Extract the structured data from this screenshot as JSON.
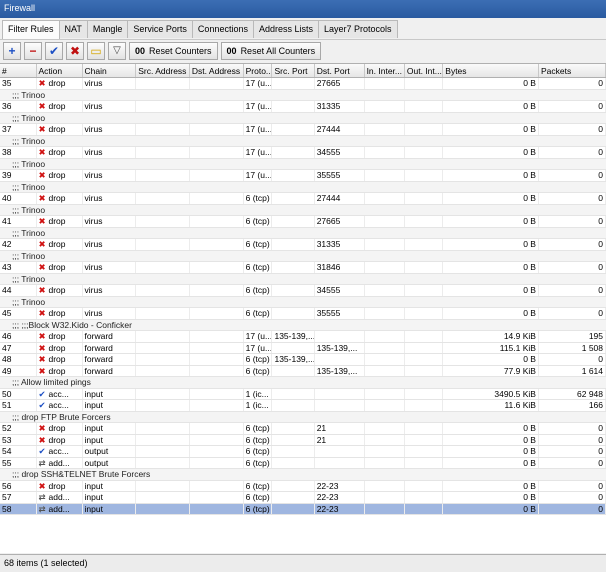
{
  "window": {
    "title": "Firewall"
  },
  "tabs": [
    "Filter Rules",
    "NAT",
    "Mangle",
    "Service Ports",
    "Connections",
    "Address Lists",
    "Layer7 Protocols"
  ],
  "toolbar": {
    "reset_counters": "Reset Counters",
    "reset_all_counters": "Reset All Counters",
    "oo": "00"
  },
  "columns": [
    "#",
    "Action",
    "Chain",
    "Src. Address",
    "Dst. Address",
    "Proto...",
    "Src. Port",
    "Dst. Port",
    "In. Inter...",
    "Out. Int...",
    "Bytes",
    "Packets"
  ],
  "rows": [
    {
      "type": "rule",
      "n": "35",
      "icon": "x",
      "action": "drop",
      "chain": "virus",
      "src": "",
      "dst": "",
      "proto": "17 (u...",
      "sport": "",
      "dport": "27665",
      "in": "",
      "out": "",
      "bytes": "0 B",
      "packets": "0"
    },
    {
      "type": "comment",
      "text": ";;; Trinoo"
    },
    {
      "type": "rule",
      "n": "36",
      "icon": "x",
      "action": "drop",
      "chain": "virus",
      "src": "",
      "dst": "",
      "proto": "17 (u...",
      "sport": "",
      "dport": "31335",
      "in": "",
      "out": "",
      "bytes": "0 B",
      "packets": "0"
    },
    {
      "type": "comment",
      "text": ";;; Trinoo"
    },
    {
      "type": "rule",
      "n": "37",
      "icon": "x",
      "action": "drop",
      "chain": "virus",
      "src": "",
      "dst": "",
      "proto": "17 (u...",
      "sport": "",
      "dport": "27444",
      "in": "",
      "out": "",
      "bytes": "0 B",
      "packets": "0"
    },
    {
      "type": "comment",
      "text": ";;; Trinoo"
    },
    {
      "type": "rule",
      "n": "38",
      "icon": "x",
      "action": "drop",
      "chain": "virus",
      "src": "",
      "dst": "",
      "proto": "17 (u...",
      "sport": "",
      "dport": "34555",
      "in": "",
      "out": "",
      "bytes": "0 B",
      "packets": "0"
    },
    {
      "type": "comment",
      "text": ";;; Trinoo"
    },
    {
      "type": "rule",
      "n": "39",
      "icon": "x",
      "action": "drop",
      "chain": "virus",
      "src": "",
      "dst": "",
      "proto": "17 (u...",
      "sport": "",
      "dport": "35555",
      "in": "",
      "out": "",
      "bytes": "0 B",
      "packets": "0"
    },
    {
      "type": "comment",
      "text": ";;; Trinoo"
    },
    {
      "type": "rule",
      "n": "40",
      "icon": "x",
      "action": "drop",
      "chain": "virus",
      "src": "",
      "dst": "",
      "proto": "6 (tcp)",
      "sport": "",
      "dport": "27444",
      "in": "",
      "out": "",
      "bytes": "0 B",
      "packets": "0"
    },
    {
      "type": "comment",
      "text": ";;; Trinoo"
    },
    {
      "type": "rule",
      "n": "41",
      "icon": "x",
      "action": "drop",
      "chain": "virus",
      "src": "",
      "dst": "",
      "proto": "6 (tcp)",
      "sport": "",
      "dport": "27665",
      "in": "",
      "out": "",
      "bytes": "0 B",
      "packets": "0"
    },
    {
      "type": "comment",
      "text": ";;; Trinoo"
    },
    {
      "type": "rule",
      "n": "42",
      "icon": "x",
      "action": "drop",
      "chain": "virus",
      "src": "",
      "dst": "",
      "proto": "6 (tcp)",
      "sport": "",
      "dport": "31335",
      "in": "",
      "out": "",
      "bytes": "0 B",
      "packets": "0"
    },
    {
      "type": "comment",
      "text": ";;; Trinoo"
    },
    {
      "type": "rule",
      "n": "43",
      "icon": "x",
      "action": "drop",
      "chain": "virus",
      "src": "",
      "dst": "",
      "proto": "6 (tcp)",
      "sport": "",
      "dport": "31846",
      "in": "",
      "out": "",
      "bytes": "0 B",
      "packets": "0"
    },
    {
      "type": "comment",
      "text": ";;; Trinoo"
    },
    {
      "type": "rule",
      "n": "44",
      "icon": "x",
      "action": "drop",
      "chain": "virus",
      "src": "",
      "dst": "",
      "proto": "6 (tcp)",
      "sport": "",
      "dport": "34555",
      "in": "",
      "out": "",
      "bytes": "0 B",
      "packets": "0"
    },
    {
      "type": "comment",
      "text": ";;; Trinoo"
    },
    {
      "type": "rule",
      "n": "45",
      "icon": "x",
      "action": "drop",
      "chain": "virus",
      "src": "",
      "dst": "",
      "proto": "6 (tcp)",
      "sport": "",
      "dport": "35555",
      "in": "",
      "out": "",
      "bytes": "0 B",
      "packets": "0"
    },
    {
      "type": "comment",
      "text": ";;; ;;;Block W32.Kido - Conficker"
    },
    {
      "type": "rule",
      "n": "46",
      "icon": "x",
      "action": "drop",
      "chain": "forward",
      "src": "",
      "dst": "",
      "proto": "17 (u...",
      "sport": "135-139,...",
      "dport": "",
      "in": "",
      "out": "",
      "bytes": "14.9 KiB",
      "packets": "195"
    },
    {
      "type": "rule",
      "n": "47",
      "icon": "x",
      "action": "drop",
      "chain": "forward",
      "src": "",
      "dst": "",
      "proto": "17 (u...",
      "sport": "",
      "dport": "135-139,...",
      "in": "",
      "out": "",
      "bytes": "115.1 KiB",
      "packets": "1 508"
    },
    {
      "type": "rule",
      "n": "48",
      "icon": "x",
      "action": "drop",
      "chain": "forward",
      "src": "",
      "dst": "",
      "proto": "6 (tcp)",
      "sport": "135-139,...",
      "dport": "",
      "in": "",
      "out": "",
      "bytes": "0 B",
      "packets": "0"
    },
    {
      "type": "rule",
      "n": "49",
      "icon": "x",
      "action": "drop",
      "chain": "forward",
      "src": "",
      "dst": "",
      "proto": "6 (tcp)",
      "sport": "",
      "dport": "135-139,...",
      "in": "",
      "out": "",
      "bytes": "77.9 KiB",
      "packets": "1 614"
    },
    {
      "type": "comment",
      "text": ";;; Allow limited pings"
    },
    {
      "type": "rule",
      "n": "50",
      "icon": "ok",
      "action": "acc...",
      "chain": "input",
      "src": "",
      "dst": "",
      "proto": "1 (ic...",
      "sport": "",
      "dport": "",
      "in": "",
      "out": "",
      "bytes": "3490.5 KiB",
      "packets": "62 948"
    },
    {
      "type": "rule",
      "n": "51",
      "icon": "ok",
      "action": "acc...",
      "chain": "input",
      "src": "",
      "dst": "",
      "proto": "1 (ic...",
      "sport": "",
      "dport": "",
      "in": "",
      "out": "",
      "bytes": "11.6 KiB",
      "packets": "166"
    },
    {
      "type": "comment",
      "text": ";;; drop FTP Brute Forcers"
    },
    {
      "type": "rule",
      "n": "52",
      "icon": "x",
      "action": "drop",
      "chain": "input",
      "src": "",
      "dst": "",
      "proto": "6 (tcp)",
      "sport": "",
      "dport": "21",
      "in": "",
      "out": "",
      "bytes": "0 B",
      "packets": "0"
    },
    {
      "type": "rule",
      "n": "53",
      "icon": "x",
      "action": "drop",
      "chain": "input",
      "src": "",
      "dst": "",
      "proto": "6 (tcp)",
      "sport": "",
      "dport": "21",
      "in": "",
      "out": "",
      "bytes": "0 B",
      "packets": "0"
    },
    {
      "type": "rule",
      "n": "54",
      "icon": "ok",
      "action": "acc...",
      "chain": "output",
      "src": "",
      "dst": "",
      "proto": "6 (tcp)",
      "sport": "",
      "dport": "",
      "in": "",
      "out": "",
      "bytes": "0 B",
      "packets": "0"
    },
    {
      "type": "rule",
      "n": "55",
      "icon": "add",
      "action": "add...",
      "chain": "output",
      "src": "",
      "dst": "",
      "proto": "6 (tcp)",
      "sport": "",
      "dport": "",
      "in": "",
      "out": "",
      "bytes": "0 B",
      "packets": "0"
    },
    {
      "type": "comment",
      "text": ";;; drop SSH&TELNET Brute Forcers"
    },
    {
      "type": "rule",
      "n": "56",
      "icon": "x",
      "action": "drop",
      "chain": "input",
      "src": "",
      "dst": "",
      "proto": "6 (tcp)",
      "sport": "",
      "dport": "22-23",
      "in": "",
      "out": "",
      "bytes": "0 B",
      "packets": "0"
    },
    {
      "type": "rule",
      "n": "57",
      "icon": "add",
      "action": "add...",
      "chain": "input",
      "src": "",
      "dst": "",
      "proto": "6 (tcp)",
      "sport": "",
      "dport": "22-23",
      "in": "",
      "out": "",
      "bytes": "0 B",
      "packets": "0"
    },
    {
      "type": "rule",
      "n": "58",
      "icon": "add",
      "action": "add...",
      "chain": "input",
      "src": "",
      "dst": "",
      "proto": "6 (tcp)",
      "sport": "",
      "dport": "22-23",
      "in": "",
      "out": "",
      "bytes": "0 B",
      "packets": "0",
      "selected": true
    }
  ],
  "status": {
    "text": "68 items (1 selected)"
  },
  "colors": {
    "title_bar": "#2a5aa0",
    "selected_row": "#9fb6e0",
    "drop_icon": "#d01010",
    "accept_icon": "#1c4fc4"
  },
  "icons": {
    "drop": "x-icon",
    "accept": "check-icon",
    "add": "add-to-list-icon"
  }
}
